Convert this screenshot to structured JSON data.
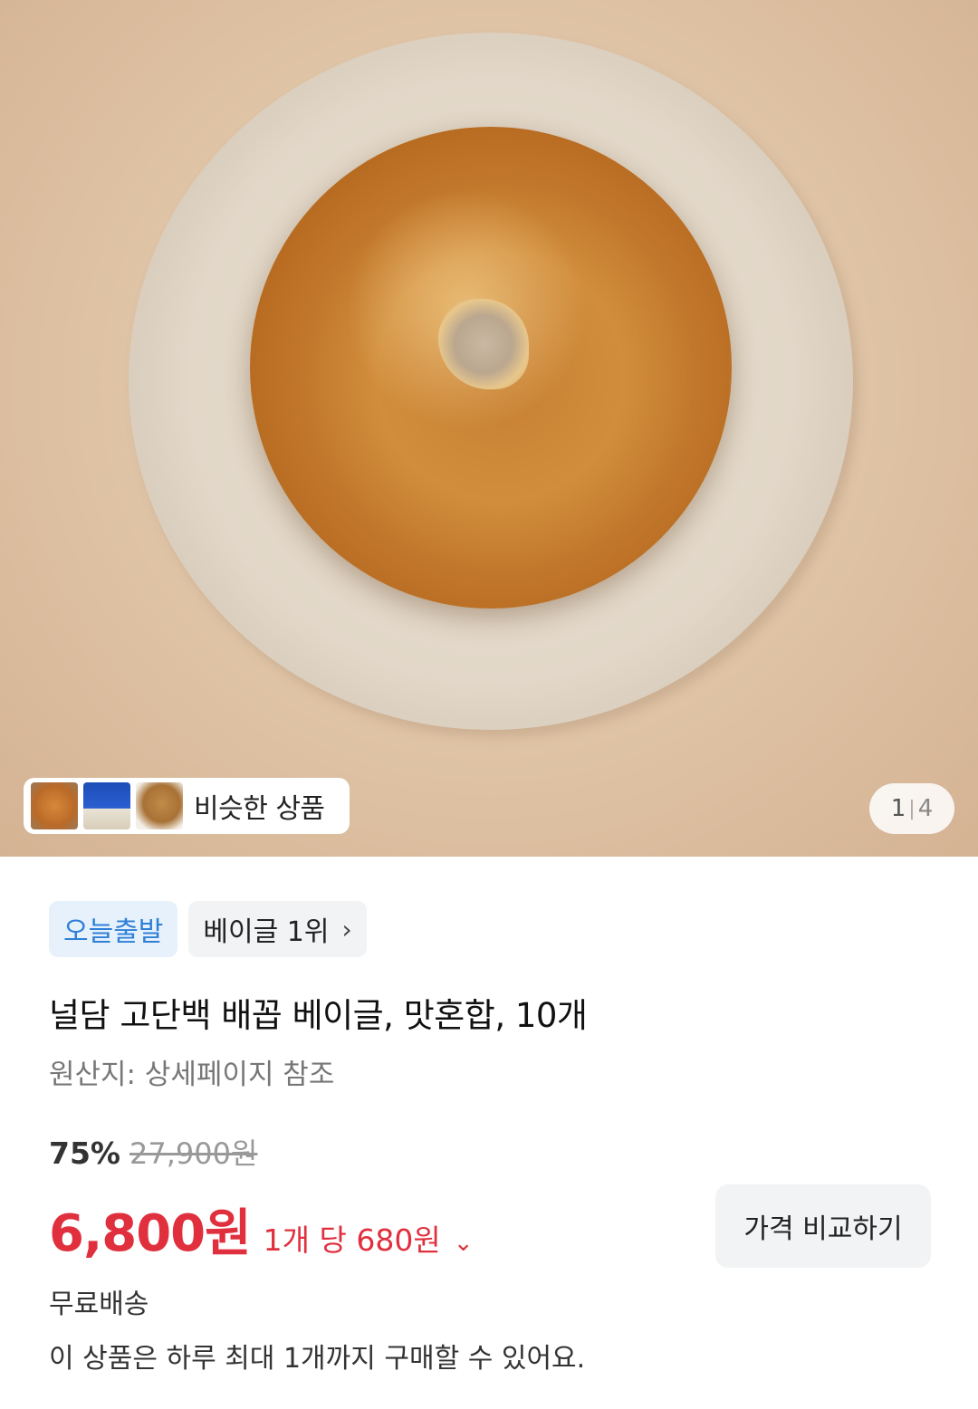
{
  "gallery": {
    "similar_label": "비슷한 상품",
    "page_current": "1",
    "page_separator": "|",
    "page_total": "4"
  },
  "badges": {
    "today": "오늘출발",
    "rank": "베이글 1위",
    "rank_chevron": "›"
  },
  "product": {
    "title": "널담 고단백 배꼽 베이글, 맛혼합, 10개",
    "origin": "원산지: 상세페이지 참조"
  },
  "price": {
    "discount_rate": "75%",
    "original": "27,900원",
    "sale": "6,800원",
    "unit": "1개 당 680원",
    "unit_chevron": "⌄",
    "compare_label": "가격 비교하기"
  },
  "delivery": {
    "shipping": "무료배송",
    "purchase_limit": "이 상품은 하루 최대 1개까지 구매할 수 있어요."
  },
  "colors": {
    "sale_red": "#e0303e",
    "today_blue": "#2f7fd7"
  }
}
